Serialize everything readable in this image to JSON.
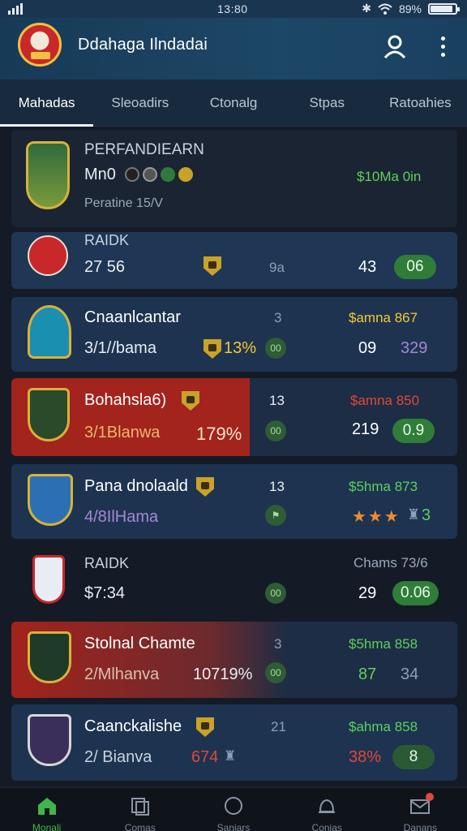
{
  "status": {
    "time": "13:80",
    "battery": "89%",
    "battery_level": 0.89
  },
  "app": {
    "title": "Ddahaga Ilndadai"
  },
  "tabs": [
    {
      "label": "Mahadas",
      "active": true
    },
    {
      "label": "Sleoadirs"
    },
    {
      "label": "Ctonalg"
    },
    {
      "label": "Stpas"
    },
    {
      "label": "Ratoahies"
    }
  ],
  "items": [
    {
      "name": "PERFANDIEARN",
      "line2": "Mn0",
      "line3": "Peratine 15/V",
      "right": "$10Ma 0in"
    },
    {
      "name": "RAIDK",
      "line2": "27 56",
      "mid": "9a",
      "num": "43",
      "pill": "06"
    },
    {
      "name": "Cnaanlcantar",
      "line2": "3/1//bama",
      "pct": "13%",
      "rank": "3",
      "badge": "00",
      "right": "$amna 867",
      "num": "09",
      "num2": "329"
    },
    {
      "name": "Bohahsla6)",
      "line2": "3/1Blanwa",
      "pct": "179%",
      "rank": "13",
      "badge": "00",
      "right": "$amna 850",
      "num": "219",
      "pill": "0.9"
    },
    {
      "name": "Pana dnolaald",
      "line2": "4/8IlHama",
      "rank": "13",
      "right": "$5hma 873",
      "stars": "★★★",
      "num2": "3"
    },
    {
      "name": "RAIDK",
      "line2": "$7:34",
      "badge": "00",
      "right": "Chams 73/6",
      "num": "29",
      "pill": "0.06"
    },
    {
      "name": "Stolnal Chamte",
      "line2": "2/Mlhanva",
      "pct": "10719%",
      "rank": "3",
      "badge": "00",
      "right": "$5hma 858",
      "num": "87",
      "num2": "34"
    },
    {
      "name": "Caanckalishe",
      "line2": "2/ Bianva",
      "pct": "674",
      "rank": "21",
      "right": "$ahma 858",
      "num": "38%",
      "pill": "8"
    }
  ],
  "nav": [
    {
      "label": "Monali",
      "icon": "home-icon",
      "active": true
    },
    {
      "label": "Comas",
      "icon": "copy-icon"
    },
    {
      "label": "Saniars",
      "icon": "circle-icon"
    },
    {
      "label": "Conias",
      "icon": "bell-icon"
    },
    {
      "label": "Danans",
      "icon": "mail-icon"
    }
  ],
  "colors": {
    "background": "#141b27",
    "header": "#1d4766",
    "accent_green": "#3fb64a",
    "highlight_red": "#a3231d"
  }
}
